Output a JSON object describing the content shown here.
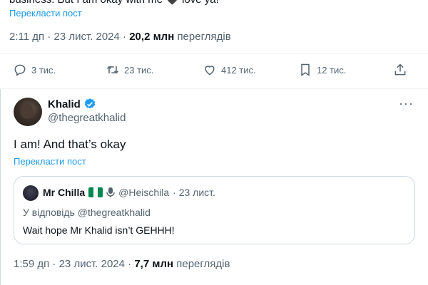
{
  "tweet1": {
    "text_partial": "business. But I am okay with me 🖤 love ya!",
    "translate_label": "Перекласти пост",
    "time": "2:11 дп",
    "date": "23 лист. 2024",
    "views_count": "20,2 млн",
    "views_label": "переглядів",
    "actions": {
      "replies": "3 тис.",
      "retweets": "23 тис.",
      "likes": "412 тис.",
      "bookmarks": "12 тис."
    }
  },
  "tweet2": {
    "author_name": "Khalid",
    "author_handle": "@thegreatkhalid",
    "more_label": "···",
    "text": "I am! And that’s okay",
    "translate_label": "Перекласти пост",
    "quote": {
      "author_name": "Mr Chilla",
      "author_handle": "@Heischila",
      "date": "· 23 лист.",
      "reply_to": "У відповідь @thegreatkhalid",
      "text": "Wait hope Mr Khalid isn’t GEHHH!"
    },
    "time": "1:59 дп",
    "date": "23 лист. 2024",
    "views_count": "7,7 млн",
    "views_label": "переглядів"
  },
  "colors": {
    "accent": "#1d9bf0",
    "muted": "#536471",
    "text": "#0f1419",
    "border": "#cfd9de",
    "flag_green": "#008751"
  },
  "icons": [
    "reply-icon",
    "retweet-icon",
    "like-icon",
    "bookmark-icon",
    "share-icon",
    "verified-badge-icon",
    "nigeria-flag-icon",
    "microphone-icon",
    "more-icon"
  ]
}
